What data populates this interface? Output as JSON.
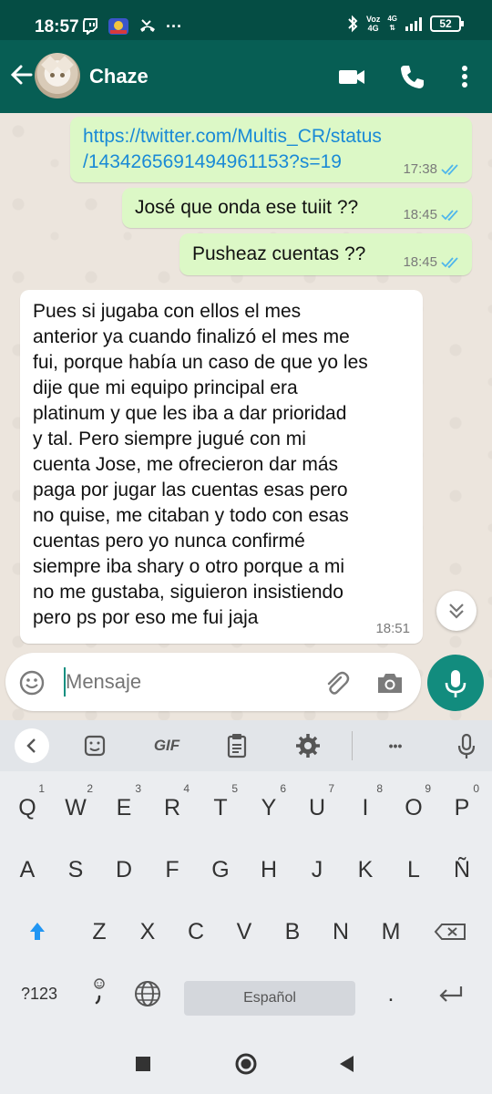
{
  "status_bar": {
    "time": "18:57",
    "dots": "···",
    "network_labels": [
      "Voz",
      "4G",
      "4G"
    ],
    "battery": "52"
  },
  "header": {
    "contact_name": "Chaze",
    "icons": [
      "back-arrow-icon",
      "video-call-icon",
      "phone-icon",
      "more-vert-icon"
    ]
  },
  "messages": [
    {
      "direction": "out",
      "lines": [
        "https://twitter.com/Multis_CR/status",
        "/1434265691494961153?s=19"
      ],
      "time": "17:38",
      "status": "read"
    },
    {
      "direction": "out",
      "lines": [
        "José que onda ese tuiit ??"
      ],
      "time": "18:45",
      "status": "read"
    },
    {
      "direction": "out",
      "lines": [
        "Pusheaz cuentas ??"
      ],
      "time": "18:45",
      "status": "read"
    },
    {
      "direction": "in",
      "lines": [
        "Pues si jugaba con ellos  el mes",
        "anterior ya cuando finalizó el mes me",
        "fui, porque había un caso de que yo les",
        "dije que mi equipo principal era",
        "platinum y que les iba  a dar prioridad",
        "y tal. Pero siempre jugué con mi",
        "cuenta Jose, me ofrecieron dar más",
        "paga por jugar las cuentas esas pero",
        "no quise, me citaban y todo con esas",
        "cuentas pero yo nunca confirmé",
        "siempre iba shary o otro porque a mi",
        "no me gustaba, siguieron insistiendo",
        "pero ps por eso me fui jaja"
      ],
      "time": "18:51"
    }
  ],
  "input": {
    "placeholder": "Mensaje"
  },
  "keyboard": {
    "toolbar": {
      "gif": "GIF",
      "more": "•••"
    },
    "row1": [
      "Q",
      "W",
      "E",
      "R",
      "T",
      "Y",
      "U",
      "I",
      "O",
      "P"
    ],
    "row1_hints": [
      "",
      "1",
      "2",
      "3",
      "4",
      "5",
      "6",
      "7",
      "8",
      "9",
      "0"
    ],
    "row2": [
      "A",
      "S",
      "D",
      "F",
      "G",
      "H",
      "J",
      "K",
      "L",
      "Ñ"
    ],
    "row3": [
      "Z",
      "X",
      "C",
      "V",
      "B",
      "N",
      "M"
    ],
    "symbols": "?123",
    "space": "Español",
    "period": "."
  },
  "colors": {
    "header": "#075e54",
    "status_bar": "#054d44",
    "outgoing": "#dcf8c6",
    "accent": "#128c7e",
    "link": "#1a8ad6",
    "tick": "#4fb6ec"
  }
}
